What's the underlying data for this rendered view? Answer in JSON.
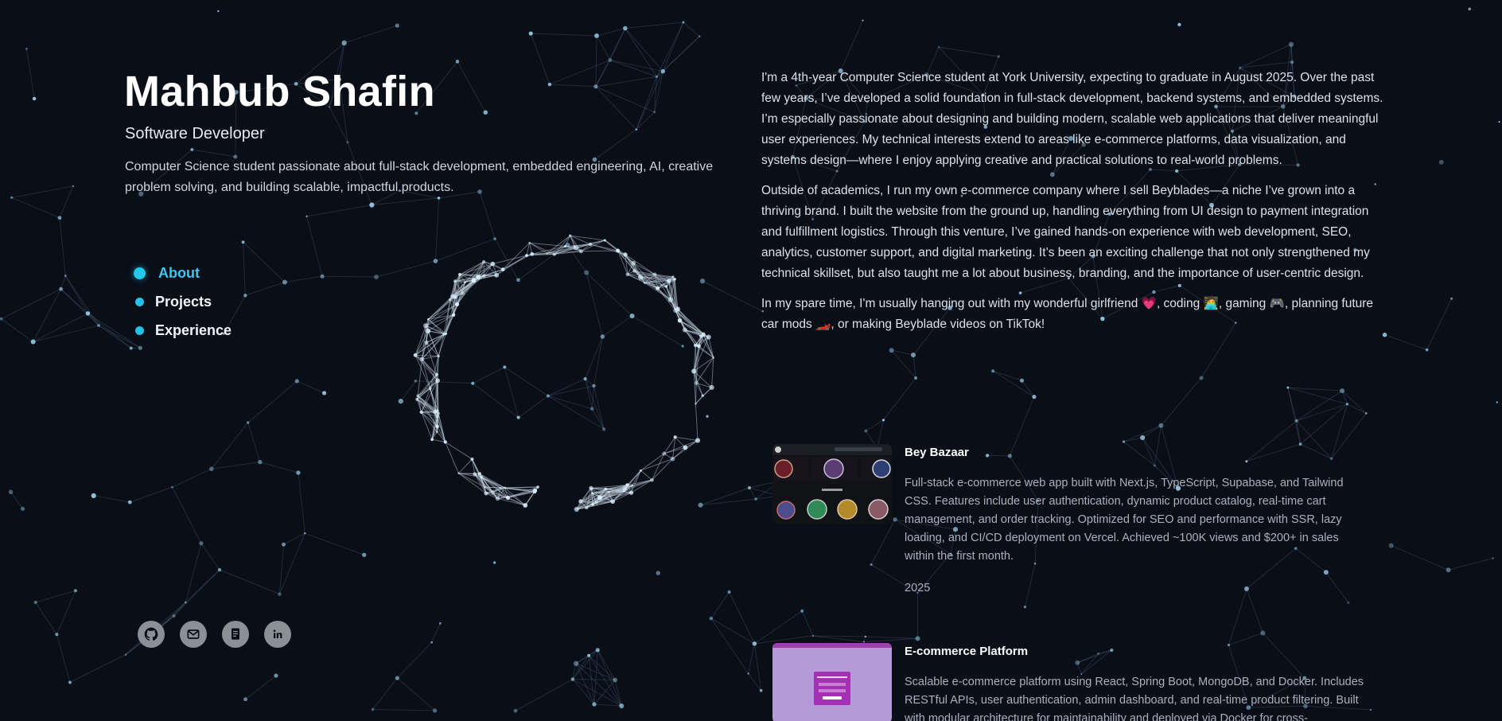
{
  "header": {
    "name": "Mahbub Shafin",
    "role": "Software Developer",
    "tagline": "Computer Science student passionate about full-stack development, embedded engineering, AI, creative problem solving, and building scalable, impactful products."
  },
  "nav": {
    "items": [
      {
        "label": "About",
        "active": true
      },
      {
        "label": "Projects",
        "active": false
      },
      {
        "label": "Experience",
        "active": false
      }
    ]
  },
  "socials": [
    {
      "icon": "github-icon"
    },
    {
      "icon": "mail-icon"
    },
    {
      "icon": "resume-icon"
    },
    {
      "icon": "linkedin-icon"
    }
  ],
  "about": {
    "paragraphs": [
      "I'm a 4th-year Computer Science student at York University, expecting to graduate in August 2025. Over the past few years, I’ve developed a solid foundation in full-stack development, backend systems, and embedded systems. I’m especially passionate about designing and building modern, scalable web applications that deliver meaningful user experiences. My technical interests extend to areas like e-commerce platforms, data visualization, and systems design—where I enjoy applying creative and practical solutions to real-world problems.",
      "Outside of academics, I run my own e-commerce company where I sell Beyblades—a niche I’ve grown into a thriving brand. I built the website from the ground up, handling everything from UI design to payment integration and fulfillment logistics. Through this venture, I’ve gained hands-on experience with web development, SEO, analytics, customer support, and digital marketing. It’s been an exciting challenge that not only strengthened my technical skillset, but also taught me a lot about business, branding, and the importance of user-centric design.",
      "In my spare time, I'm usually hanging out with my wonderful girlfriend 💗, coding 🧑‍💻, gaming 🎮, planning future car mods 🏎️, or making Beyblade videos on TikTok!"
    ]
  },
  "projects": [
    {
      "title": "Bey Bazaar",
      "description": "Full-stack e-commerce web app built with Next.js, TypeScript, Supabase, and Tailwind CSS. Features include user authentication, dynamic product catalog, real-time cart management, and order tracking. Optimized for SEO and performance with SSR, lazy loading, and CI/CD deployment on Vercel. Achieved ~100K views and $200+ in sales within the first month.",
      "year": "2025"
    },
    {
      "title": "E-commerce Platform",
      "description": "Scalable e-commerce platform using React, Spring Boot, MongoDB, and Docker. Includes RESTful APIs, user authentication, admin dashboard, and real-time product filtering. Built with modular architecture for maintainability and deployed via Docker for cross-",
      "year": ""
    }
  ],
  "colors": {
    "background": "#0a0e17",
    "accent": "#22c3e6",
    "text_muted": "#a9b1bd"
  }
}
